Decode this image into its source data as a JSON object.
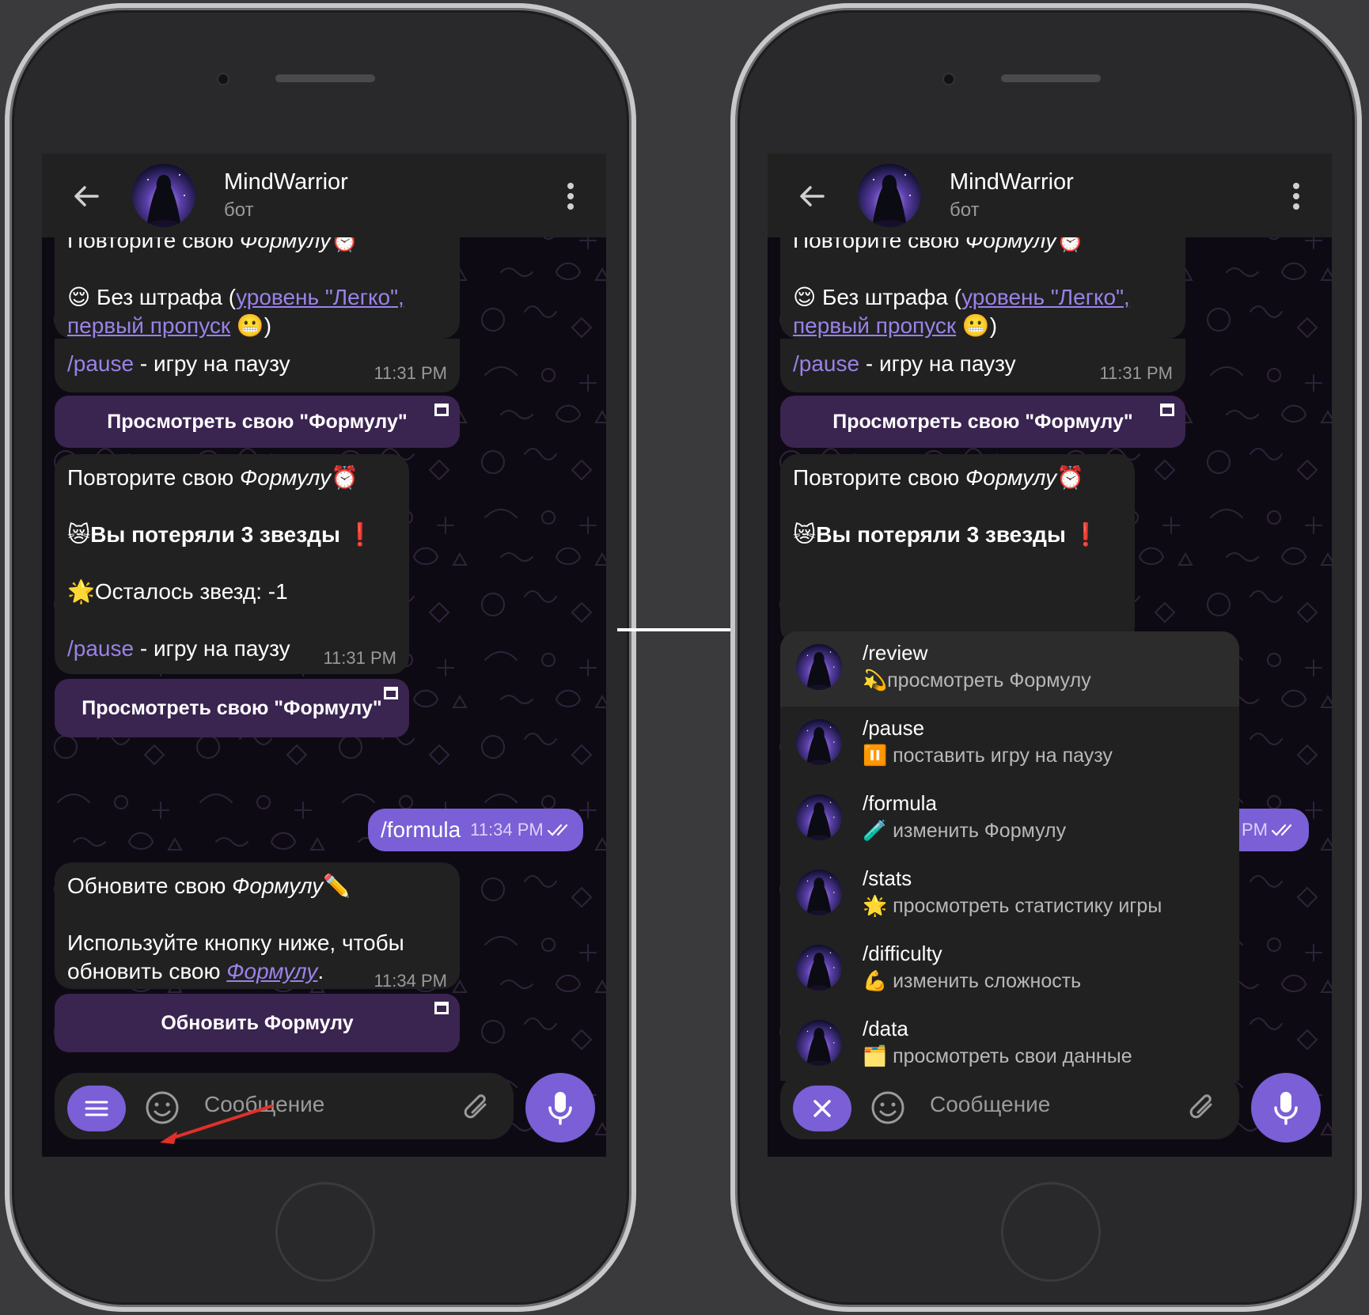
{
  "chat": {
    "title": "MindWarrior",
    "subtitle": "бот",
    "input_placeholder": "Сообщение"
  },
  "messages": {
    "m1": {
      "line1_pre": "Повторите свою ",
      "line1_it": "Формулу",
      "line1_emoji": "⏰",
      "line2_emoji": "😌",
      "line2_pre": " Без штрафа (",
      "line2_link": "уровень \"Легко\",",
      "line3_link": "первый пропуск",
      "line3_emoji": " 😬",
      "line3_post": ")",
      "cmd": "/pause",
      "cmd_text": " - игру на паузу",
      "time": "11:31 PM"
    },
    "btn1": "Просмотреть свою \"Формулу\"",
    "m2": {
      "line1_pre": "Повторите свою ",
      "line1_it": "Формулу",
      "line1_emoji": "⏰",
      "line2_emoji": "😿",
      "line2_text": "Вы потеряли 3 звезды",
      "line2_end": "❗",
      "line3_emoji": "🌟",
      "line3_text": "Осталось звезд: -1",
      "cmd": "/pause",
      "cmd_text": " - игру на паузу",
      "time": "11:31 PM"
    },
    "btn2": "Просмотреть свою \"Формулу\"",
    "out": {
      "text": "/formula",
      "time": "11:34 PM",
      "time_partial": "4 PM"
    },
    "m3": {
      "line1_pre": "Обновите свою ",
      "line1_it": "Формулу",
      "line1_emoji": "✏️",
      "line2": "Используйте кнопку ниже, чтобы",
      "line3_pre": "обновить свою ",
      "line3_link": "Формулу",
      "line3_post": ".",
      "time": "11:34 PM"
    },
    "btn3": "Обновить Формулу"
  },
  "commands": [
    {
      "name": "/review",
      "emoji": "💫",
      "desc": "просмотреть Формулу",
      "icon": "avatar"
    },
    {
      "name": "/pause",
      "emoji": "⏸️",
      "desc": " поставить игру на паузу",
      "icon": "avatar"
    },
    {
      "name": "/formula",
      "emoji": "🧪",
      "desc": " изменить Формулу",
      "icon": "avatar"
    },
    {
      "name": "/stats",
      "emoji": "🌟",
      "desc": " просмотреть статистику игры",
      "icon": "avatar"
    },
    {
      "name": "/difficulty",
      "emoji": "💪",
      "desc": " изменить сложность",
      "icon": "avatar"
    },
    {
      "name": "/data",
      "emoji": "🗂️",
      "desc": " просмотреть свои данные",
      "icon": "avatar"
    }
  ],
  "colors": {
    "accent": "#7a5fd6",
    "link": "#9a82e8",
    "bubble": "#212121",
    "button": "#3a2450",
    "annotation_arrow": "#e0302a"
  }
}
